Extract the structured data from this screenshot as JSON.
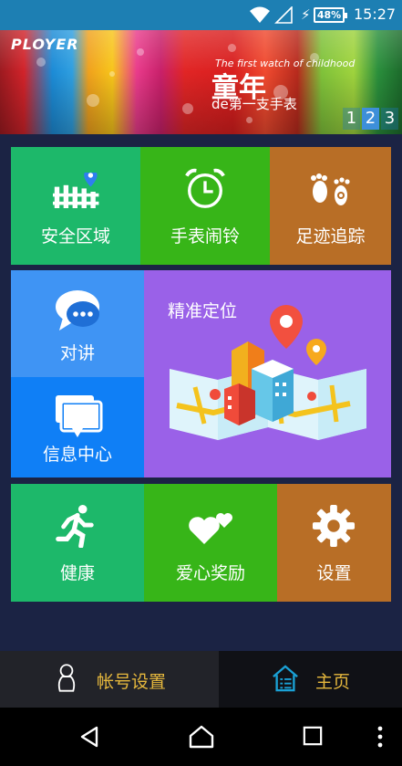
{
  "status_bar": {
    "battery": "48%",
    "time": "15:27"
  },
  "banner": {
    "logo": "PLOYER",
    "tagline": "The first watch of childhood",
    "title": "童年",
    "subtitle": "de第一支手表",
    "pages": [
      "1",
      "2",
      "3"
    ],
    "active_page": "2"
  },
  "tiles": {
    "safe_zone": "安全区域",
    "alarm": "手表闹铃",
    "footprint": "足迹追踪",
    "intercom": "对讲",
    "messages": "信息中心",
    "locate": "精准定位",
    "health": "健康",
    "reward": "爱心奖励",
    "settings": "设置"
  },
  "colors": {
    "green": "#1db86a",
    "orange": "#b86e26",
    "blue_light": "#3f94f4",
    "blue": "#0f7ff6",
    "purple": "#9a61e8",
    "background": "#1b2344"
  },
  "bottom_nav": {
    "account": "帐号设置",
    "home": "主页"
  }
}
